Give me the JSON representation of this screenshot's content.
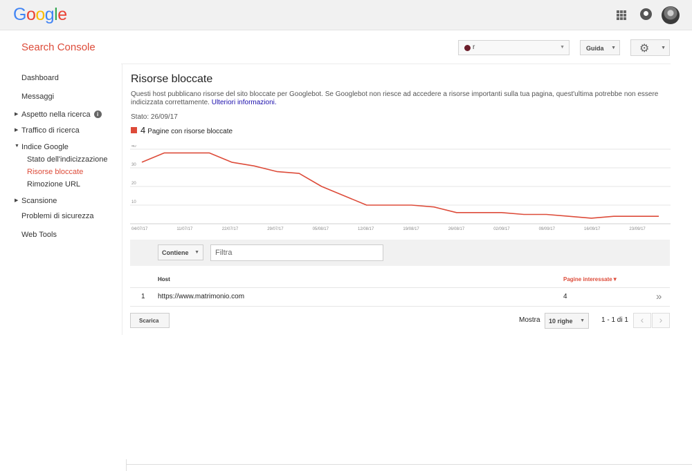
{
  "google_logo": "Google",
  "header": {
    "title": "Search Console",
    "property_value": "r",
    "help_label": "Guida",
    "settings_icon": "gear-icon"
  },
  "sidebar": {
    "items": [
      {
        "label": "Dashboard"
      },
      {
        "label": "Messaggi"
      },
      {
        "label": "Aspetto nella ricerca",
        "expandable": true
      },
      {
        "label": "Traffico di ricerca",
        "expandable": true
      },
      {
        "label": "Indice Google",
        "expanded": true
      },
      {
        "label": "Stato dell'indicizzazione"
      },
      {
        "label": "Risorse bloccate",
        "active": true
      },
      {
        "label": "Rimozione URL"
      },
      {
        "label": "Scansione",
        "expandable": true
      },
      {
        "label": "Problemi di sicurezza"
      },
      {
        "label": "Web Tools"
      }
    ]
  },
  "main": {
    "title": "Risorse bloccate",
    "description": "Questi host pubblicano risorse del sito bloccate per Googlebot. Se Googlebot non riesce ad accedere a risorse importanti sulla tua pagina, quest'ultima potrebbe non essere indicizzata correttamente.",
    "more_info_link": "Ulteriori informazioni.",
    "status": "Stato: 26/09/17",
    "legend_count": "4",
    "legend_label": "Pagine con risorse bloccate"
  },
  "chart_data": {
    "type": "line",
    "series": [
      {
        "name": "Pagine con risorse bloccate",
        "color": "#dd4b39",
        "values": [
          33,
          38,
          38,
          38,
          33,
          31,
          28,
          27,
          20,
          15,
          10,
          10,
          10,
          9,
          6,
          6,
          6,
          5,
          5,
          4,
          3,
          4,
          4,
          4
        ]
      }
    ],
    "x_tick_labels": [
      "04/07/17",
      "11/07/17",
      "22/07/17",
      "29/07/17",
      "05/08/17",
      "12/08/17",
      "19/08/17",
      "26/08/17",
      "02/09/17",
      "09/09/17",
      "16/09/17",
      "23/09/17"
    ],
    "y_ticks": [
      10,
      20,
      30,
      40
    ],
    "ylim": [
      0,
      40
    ],
    "grid": true
  },
  "filter": {
    "mode_label": "Contiene",
    "placeholder": "Filtra"
  },
  "table": {
    "columns": [
      "Host",
      "Pagine interessate"
    ],
    "sort_indicator": "▼",
    "rows": [
      {
        "index": "1",
        "host": "https://www.matrimonio.com",
        "pages": "4"
      }
    ]
  },
  "footer": {
    "download_label": "Scarica",
    "show_label": "Mostra",
    "rows_per_page": "10 righe",
    "page_info": "1 - 1 di 1"
  }
}
